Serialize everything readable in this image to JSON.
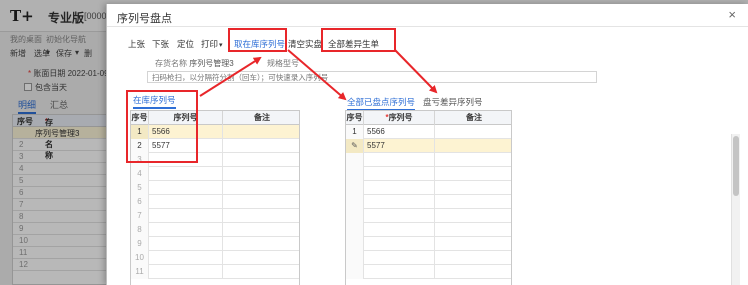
{
  "background": {
    "logo": "T+",
    "brand": "专业版",
    "doc_id": "[00000",
    "nav": [
      "我的桌面",
      "初始化导航"
    ],
    "toolbar": [
      "新增",
      "选单",
      "保存",
      "删"
    ],
    "date_label": "账面日期",
    "date_value": "2022-01-09",
    "include_today": "包含当天",
    "tabs": [
      "明细",
      "汇总"
    ],
    "grid_headers": [
      "序号",
      "存货名称"
    ],
    "grid_rows": [
      {
        "num": "",
        "name": "序列号管理3"
      },
      {
        "num": "2",
        "name": ""
      },
      {
        "num": "3",
        "name": ""
      },
      {
        "num": "4",
        "name": ""
      },
      {
        "num": "5",
        "name": ""
      },
      {
        "num": "6",
        "name": ""
      },
      {
        "num": "7",
        "name": ""
      },
      {
        "num": "8",
        "name": ""
      },
      {
        "num": "9",
        "name": ""
      },
      {
        "num": "10",
        "name": ""
      },
      {
        "num": "11",
        "name": ""
      },
      {
        "num": "12",
        "name": ""
      }
    ]
  },
  "modal": {
    "title": "序列号盘点",
    "close_icon": "×",
    "toolbar": {
      "prev": "上张",
      "next": "下张",
      "locate": "定位",
      "print": "打印",
      "fetch_stock": "取在库序列号",
      "clear_count": "清空实盘",
      "gen_diff": "全部差异生单"
    },
    "item_name_label": "存货名称",
    "item_name_value": "序列号管理3",
    "spec_label": "规格型号",
    "scan_placeholder": "扫码枪扫，以分隔符分割（回车）；可快速录入序列号",
    "left_tab": "在库序列号",
    "right_tabs": [
      "全部已盘点序列号",
      "盘亏差异序列号"
    ],
    "left_headers": [
      "序号",
      "序列号",
      "备注"
    ],
    "right_headers": [
      "序号",
      "序列号",
      "备注"
    ],
    "left_rows": [
      {
        "num": "1",
        "serial": "5566",
        "note": ""
      },
      {
        "num": "2",
        "serial": "5577",
        "note": ""
      },
      {
        "num": "3",
        "serial": "",
        "note": ""
      },
      {
        "num": "4",
        "serial": "",
        "note": ""
      },
      {
        "num": "5",
        "serial": "",
        "note": ""
      },
      {
        "num": "6",
        "serial": "",
        "note": ""
      },
      {
        "num": "7",
        "serial": "",
        "note": ""
      },
      {
        "num": "8",
        "serial": "",
        "note": ""
      },
      {
        "num": "9",
        "serial": "",
        "note": ""
      },
      {
        "num": "10",
        "serial": "",
        "note": ""
      },
      {
        "num": "11",
        "serial": "",
        "note": ""
      }
    ],
    "right_rows": [
      {
        "num": "1",
        "serial": "5566",
        "note": ""
      },
      {
        "num": "",
        "serial": "5577",
        "note": ""
      },
      {
        "num": "",
        "serial": "",
        "note": ""
      },
      {
        "num": "",
        "serial": "",
        "note": ""
      },
      {
        "num": "",
        "serial": "",
        "note": ""
      },
      {
        "num": "",
        "serial": "",
        "note": ""
      },
      {
        "num": "",
        "serial": "",
        "note": ""
      },
      {
        "num": "",
        "serial": "",
        "note": ""
      },
      {
        "num": "",
        "serial": "",
        "note": ""
      },
      {
        "num": "",
        "serial": "",
        "note": ""
      },
      {
        "num": "",
        "serial": "",
        "note": ""
      }
    ]
  },
  "colors": {
    "accent": "#2f6fd6",
    "annotation_red": "#e8262a",
    "selected_row": "#fdf3d2"
  }
}
